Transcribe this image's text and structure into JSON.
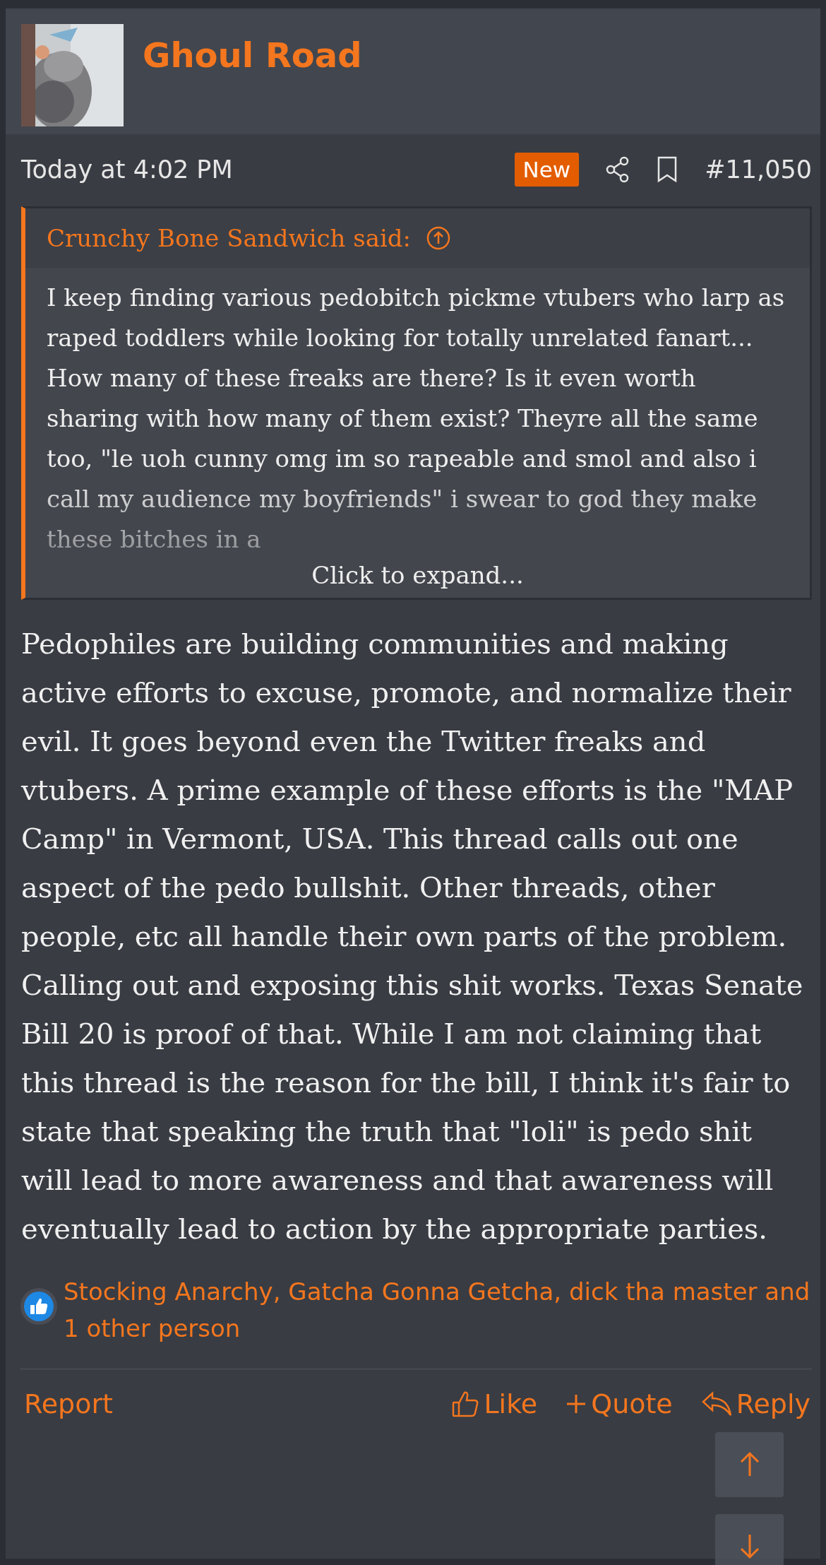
{
  "post": {
    "author": "Ghoul Road",
    "time": "Today at 4:02 PM",
    "badge": "New",
    "number": "#11,050",
    "quote": {
      "attribution": "Crunchy Bone Sandwich said:",
      "text": "I keep finding various pedobitch pickme vtubers who larp as raped toddlers while looking for totally unrelated fanart... How many of these freaks are there? Is it even worth sharing with how many of them exist? Theyre all the same too, \"le uoh cunny omg im so rapeable and smol and also i call my audience my boyfriends\" i swear to god they make these bitches in a",
      "expand": "Click to expand..."
    },
    "body": "Pedophiles are building communities and making active efforts to excuse, promote, and normalize their evil. It goes beyond even the Twitter freaks and vtubers. A prime example of these efforts is the \"MAP Camp\" in Vermont, USA. This thread calls out one aspect of the pedo bullshit. Other threads, other people, etc all handle their own parts of the problem. Calling out and exposing this shit works. Texas Senate Bill 20 is proof of that. While I am not claiming that this thread is the reason for the bill, I think it's fair to state that speaking the truth that \"loli\" is pedo shit will lead to more awareness and that awareness will eventually lead to action by the appropriate parties.",
    "reactions": "Stocking Anarchy, Gatcha Gonna Getcha, dick tha master and 1 other person",
    "actions": [
      {
        "kind": "report",
        "label": "Report"
      },
      {
        "kind": "like",
        "label": "Like"
      },
      {
        "kind": "quote",
        "label": "Quote"
      },
      {
        "kind": "reply",
        "label": "Reply"
      }
    ]
  }
}
